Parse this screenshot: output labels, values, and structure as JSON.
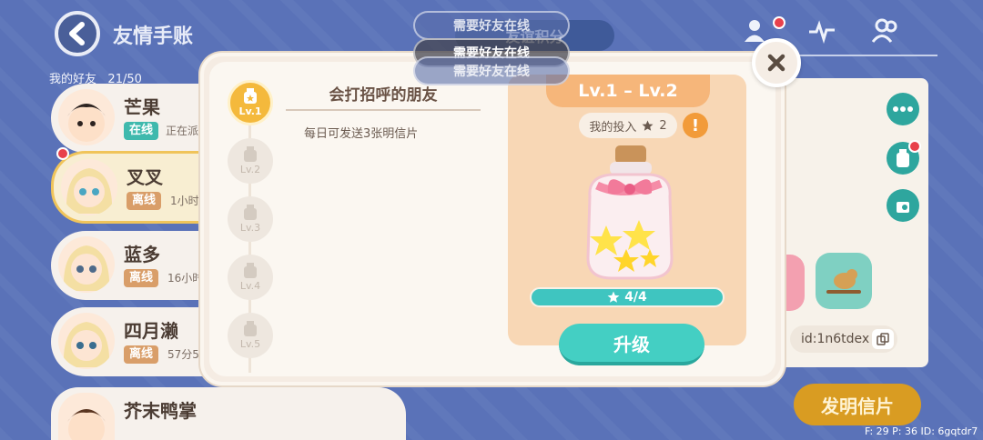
{
  "header": {
    "title": "友情手账",
    "friends_label": "我的好友",
    "friends_count": "21/50"
  },
  "toasts": [
    "需要好友在线",
    "需要好友在线",
    "需要好友在线"
  ],
  "behind_pill": "友谊积分",
  "friends": [
    {
      "name": "芒果",
      "status": "在线",
      "status_type": "online",
      "sub": "正在派"
    },
    {
      "name": "叉叉",
      "status": "离线",
      "status_type": "offline",
      "sub": "1小时前"
    },
    {
      "name": "蓝多",
      "status": "离线",
      "status_type": "offline",
      "sub": "16小时"
    },
    {
      "name": "四月濑",
      "status": "离线",
      "status_type": "offline",
      "sub": "57分5"
    },
    {
      "name": "芥末鸭掌",
      "status": "",
      "status_type": "",
      "sub": ""
    }
  ],
  "modal": {
    "levels": [
      "Lv.1",
      "Lv.2",
      "Lv.3",
      "Lv.4",
      "Lv.5"
    ],
    "active_level": "Lv.1",
    "level_title": "会打招呼的朋友",
    "level_desc": "每日可发送3张明信片",
    "reward_range": "Lv.1 – Lv.2",
    "invest_label": "我的投入",
    "invest_value": "2",
    "warn_glyph": "!",
    "progress_text": "4/4",
    "progress_fraction": 1.0,
    "upgrade_label": "升级",
    "close_glyph": "✕"
  },
  "right_panel": {
    "id_text": "id:1n6tdex"
  },
  "invent_button": "发明信片",
  "debug": "F: 29    P: 36    ID: 6gqtdr7",
  "colors": {
    "background": "#5a72b8",
    "accent_teal": "#44cfc3",
    "accent_gold": "#f4b93c",
    "reward_bg": "#f8d7b5"
  }
}
